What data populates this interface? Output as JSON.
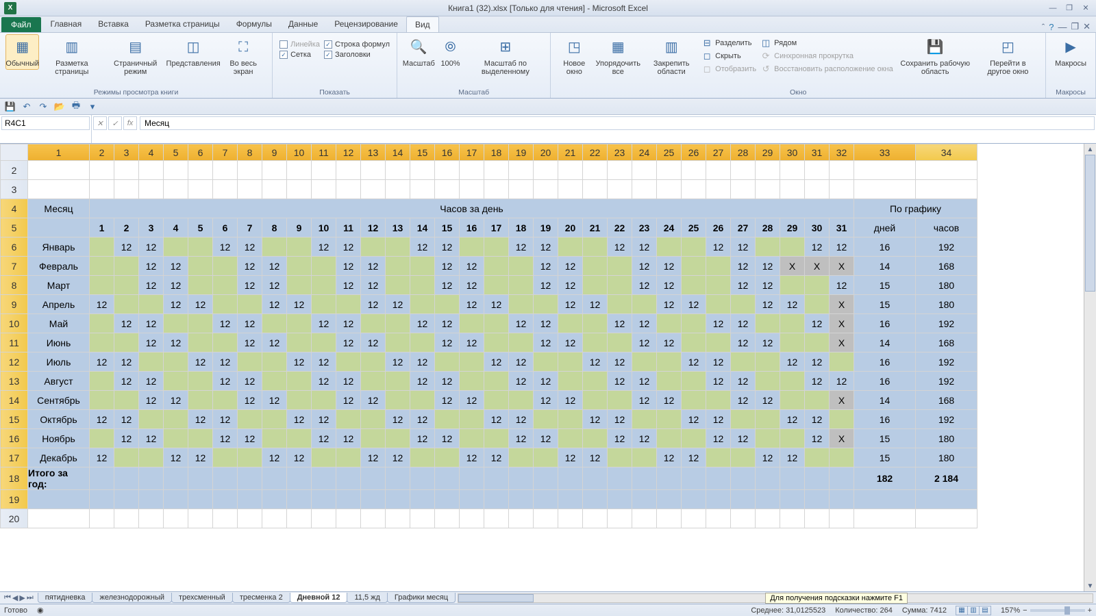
{
  "title": "Книга1 (32).xlsx  [Только для чтения]  -  Microsoft Excel",
  "excel_icon": "X",
  "tabs": {
    "file": "Файл",
    "items": [
      "Главная",
      "Вставка",
      "Разметка страницы",
      "Формулы",
      "Данные",
      "Рецензирование",
      "Вид"
    ],
    "active": "Вид"
  },
  "ribbon": {
    "view_modes": {
      "normal": "Обычный",
      "page_layout": "Разметка страницы",
      "page_break": "Страничный режим",
      "custom_views": "Представления",
      "full_screen": "Во весь экран",
      "group": "Режимы просмотра книги"
    },
    "show": {
      "ruler": "Линейка",
      "formula_bar": "Строка формул",
      "grid": "Сетка",
      "headings": "Заголовки",
      "group": "Показать"
    },
    "zoom": {
      "zoom": "Масштаб",
      "z100": "100%",
      "zoom_sel": "Масштаб по выделенному",
      "group": "Масштаб"
    },
    "window": {
      "new": "Новое окно",
      "arrange": "Упорядочить все",
      "freeze": "Закрепить области",
      "split": "Разделить",
      "hide": "Скрыть",
      "unhide": "Отобразить",
      "side": "Рядом",
      "sync": "Синхронная прокрутка",
      "reset": "Восстановить расположение окна",
      "save_ws": "Сохранить рабочую область",
      "switch": "Перейти в другое окно",
      "group": "Окно"
    },
    "macros": {
      "macros": "Макросы",
      "group": "Макросы"
    }
  },
  "namebox": "R4C1",
  "formula": "Месяц",
  "col_headers": [
    "1",
    "2",
    "3",
    "4",
    "5",
    "6",
    "7",
    "8",
    "9",
    "10",
    "11",
    "12",
    "13",
    "14",
    "15",
    "16",
    "17",
    "18",
    "19",
    "20",
    "21",
    "22",
    "23",
    "24",
    "25",
    "26",
    "27",
    "28",
    "29",
    "30",
    "31",
    "32",
    "33",
    "34"
  ],
  "row_headers": [
    "2",
    "3",
    "4",
    "5",
    "6",
    "7",
    "8",
    "9",
    "10",
    "11",
    "12",
    "13",
    "14",
    "15",
    "16",
    "17",
    "18",
    "19",
    "20"
  ],
  "table": {
    "month_hdr": "Месяц",
    "hours_hdr": "Часов за день",
    "plan_hdr": "По графику",
    "days_lbl": "дней",
    "hours_lbl": "часов",
    "day_numbers": [
      "1",
      "2",
      "3",
      "4",
      "5",
      "6",
      "7",
      "8",
      "9",
      "10",
      "11",
      "12",
      "13",
      "14",
      "15",
      "16",
      "17",
      "18",
      "19",
      "20",
      "21",
      "22",
      "23",
      "24",
      "25",
      "26",
      "27",
      "28",
      "29",
      "30",
      "31"
    ],
    "months": [
      "Январь",
      "Февраль",
      "Март",
      "Апрель",
      "Май",
      "Июнь",
      "Июль",
      "Август",
      "Сентябрь",
      "Октябрь",
      "Ноябрь",
      "Декабрь"
    ],
    "data": [
      [
        "",
        "12",
        "12",
        "",
        "",
        "12",
        "12",
        "",
        "",
        "12",
        "12",
        "",
        "",
        "12",
        "12",
        "",
        "",
        "12",
        "12",
        "",
        "",
        "12",
        "12",
        "",
        "",
        "12",
        "12",
        "",
        "",
        "12",
        "12"
      ],
      [
        "",
        "",
        "12",
        "12",
        "",
        "",
        "12",
        "12",
        "",
        "",
        "12",
        "12",
        "",
        "",
        "12",
        "12",
        "",
        "",
        "12",
        "12",
        "",
        "",
        "12",
        "12",
        "",
        "",
        "12",
        "12",
        "X",
        "X",
        "X"
      ],
      [
        "",
        "",
        "12",
        "12",
        "",
        "",
        "12",
        "12",
        "",
        "",
        "12",
        "12",
        "",
        "",
        "12",
        "12",
        "",
        "",
        "12",
        "12",
        "",
        "",
        "12",
        "12",
        "",
        "",
        "12",
        "12",
        "",
        "",
        "12"
      ],
      [
        "12",
        "",
        "",
        "12",
        "12",
        "",
        "",
        "12",
        "12",
        "",
        "",
        "12",
        "12",
        "",
        "",
        "12",
        "12",
        "",
        "",
        "12",
        "12",
        "",
        "",
        "12",
        "12",
        "",
        "",
        "12",
        "12",
        "",
        "X"
      ],
      [
        "",
        "12",
        "12",
        "",
        "",
        "12",
        "12",
        "",
        "",
        "12",
        "12",
        "",
        "",
        "12",
        "12",
        "",
        "",
        "12",
        "12",
        "",
        "",
        "12",
        "12",
        "",
        "",
        "12",
        "12",
        "",
        "",
        "12",
        "X"
      ],
      [
        "",
        "",
        "12",
        "12",
        "",
        "",
        "12",
        "12",
        "",
        "",
        "12",
        "12",
        "",
        "",
        "12",
        "12",
        "",
        "",
        "12",
        "12",
        "",
        "",
        "12",
        "12",
        "",
        "",
        "12",
        "12",
        "",
        "",
        "X"
      ],
      [
        "12",
        "12",
        "",
        "",
        "12",
        "12",
        "",
        "",
        "12",
        "12",
        "",
        "",
        "12",
        "12",
        "",
        "",
        "12",
        "12",
        "",
        "",
        "12",
        "12",
        "",
        "",
        "12",
        "12",
        "",
        "",
        "12",
        "12",
        ""
      ],
      [
        "",
        "12",
        "12",
        "",
        "",
        "12",
        "12",
        "",
        "",
        "12",
        "12",
        "",
        "",
        "12",
        "12",
        "",
        "",
        "12",
        "12",
        "",
        "",
        "12",
        "12",
        "",
        "",
        "12",
        "12",
        "",
        "",
        "12",
        "12"
      ],
      [
        "",
        "",
        "12",
        "12",
        "",
        "",
        "12",
        "12",
        "",
        "",
        "12",
        "12",
        "",
        "",
        "12",
        "12",
        "",
        "",
        "12",
        "12",
        "",
        "",
        "12",
        "12",
        "",
        "",
        "12",
        "12",
        "",
        "",
        "X"
      ],
      [
        "12",
        "12",
        "",
        "",
        "12",
        "12",
        "",
        "",
        "12",
        "12",
        "",
        "",
        "12",
        "12",
        "",
        "",
        "12",
        "12",
        "",
        "",
        "12",
        "12",
        "",
        "",
        "12",
        "12",
        "",
        "",
        "12",
        "12",
        ""
      ],
      [
        "",
        "12",
        "12",
        "",
        "",
        "12",
        "12",
        "",
        "",
        "12",
        "12",
        "",
        "",
        "12",
        "12",
        "",
        "",
        "12",
        "12",
        "",
        "",
        "12",
        "12",
        "",
        "",
        "12",
        "12",
        "",
        "",
        "12",
        "X"
      ],
      [
        "12",
        "",
        "",
        "12",
        "12",
        "",
        "",
        "12",
        "12",
        "",
        "",
        "12",
        "12",
        "",
        "",
        "12",
        "12",
        "",
        "",
        "12",
        "12",
        "",
        "",
        "12",
        "12",
        "",
        "",
        "12",
        "12",
        "",
        ""
      ]
    ],
    "plan_days": [
      "16",
      "14",
      "15",
      "15",
      "16",
      "14",
      "16",
      "16",
      "14",
      "16",
      "15",
      "15"
    ],
    "plan_hours": [
      "192",
      "168",
      "180",
      "180",
      "192",
      "168",
      "192",
      "192",
      "168",
      "192",
      "180",
      "180"
    ],
    "total_lbl": "Итого за год:",
    "total_days": "182",
    "total_hours": "2 184"
  },
  "sheet_tabs": [
    "пятидневка",
    "железнодорожный",
    "трехсменный",
    "тресменка 2",
    "Дневной 12",
    "11,5 жд",
    "Графики месяц"
  ],
  "active_sheet": "Дневной 12",
  "hint": "Для получения подсказки нажмите F1",
  "status": {
    "ready": "Готово",
    "avg_lbl": "Среднее:",
    "avg": "31,0125523",
    "cnt_lbl": "Количество:",
    "cnt": "264",
    "sum_lbl": "Сумма:",
    "sum": "7412",
    "zoom": "157%"
  }
}
